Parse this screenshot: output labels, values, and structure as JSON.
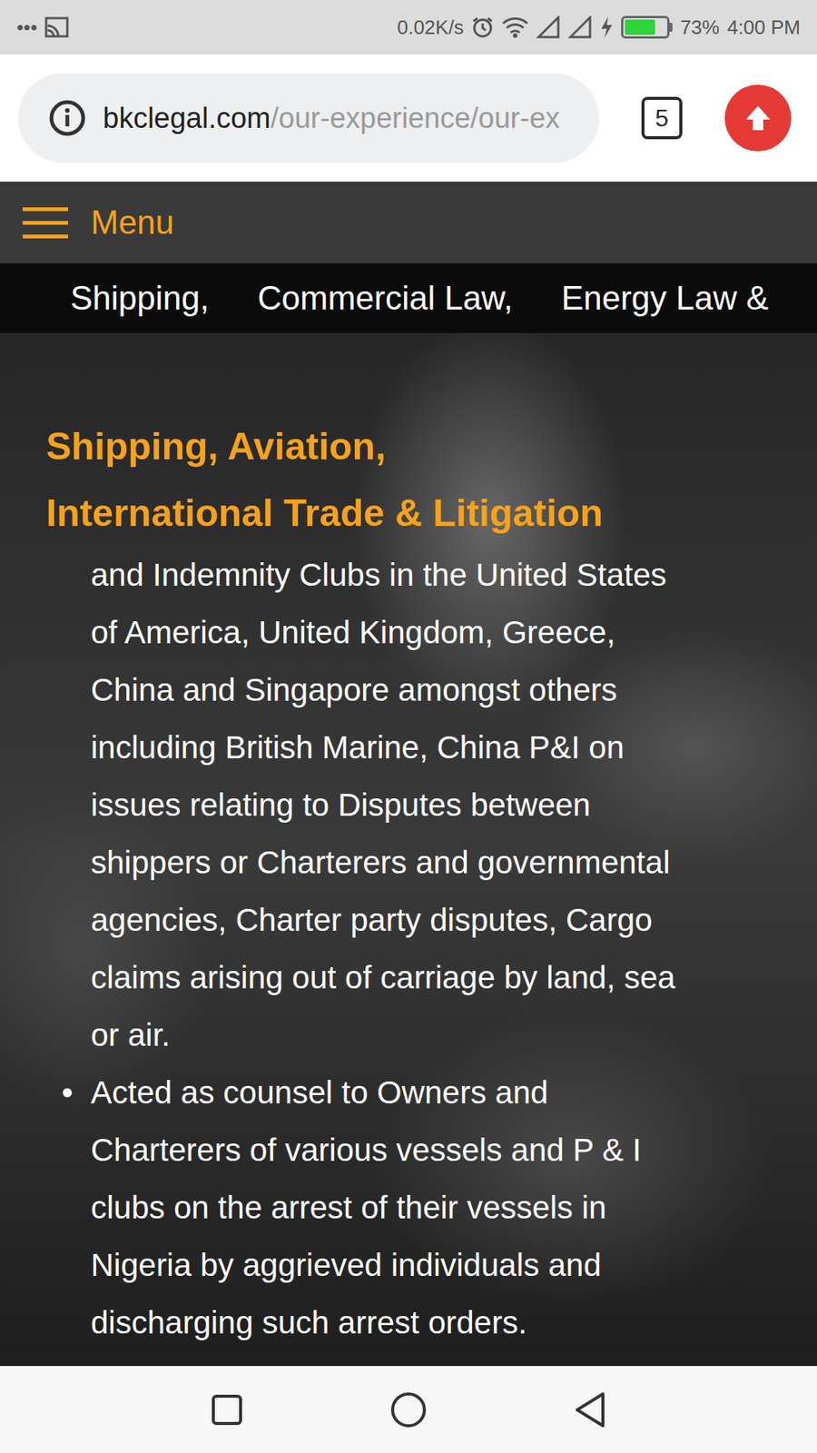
{
  "status_bar": {
    "dots": "•••",
    "speed": "0.02K/s",
    "battery": {
      "level": 0.73,
      "reading": "73%",
      "charging": true
    },
    "time": "4:00 PM"
  },
  "address_bar": {
    "domain": "bkclegal.com",
    "path": "/our-experience/our-ex",
    "tab_count": "5"
  },
  "site_header": {
    "menu_label": "Menu"
  },
  "nav": [
    {
      "label": "Shipping,"
    },
    {
      "label": "Commercial Law,"
    },
    {
      "label": "Energy Law &"
    }
  ],
  "page": {
    "title_lines": [
      "Shipping, Aviation,",
      "International Trade & Litigation"
    ],
    "items": [
      {
        "marker": false,
        "lines": [
          "and Indemnity Clubs in the United States",
          "of America, United Kingdom, Greece,",
          "China and Singapore amongst others",
          "including British Marine, China P&I on",
          "issues relating to Disputes between",
          "shippers or Charterers and governmental",
          "agencies, Charter party disputes, Cargo",
          "claims arising out of carriage by land, sea",
          "or air."
        ]
      },
      {
        "marker": true,
        "lines": [
          "Acted as counsel to Owners and",
          "Charterers of various vessels and P & I",
          "clubs on the arrest of their vessels in",
          "Nigeria by aggrieved individuals and",
          "discharging such arrest orders."
        ]
      }
    ]
  }
}
